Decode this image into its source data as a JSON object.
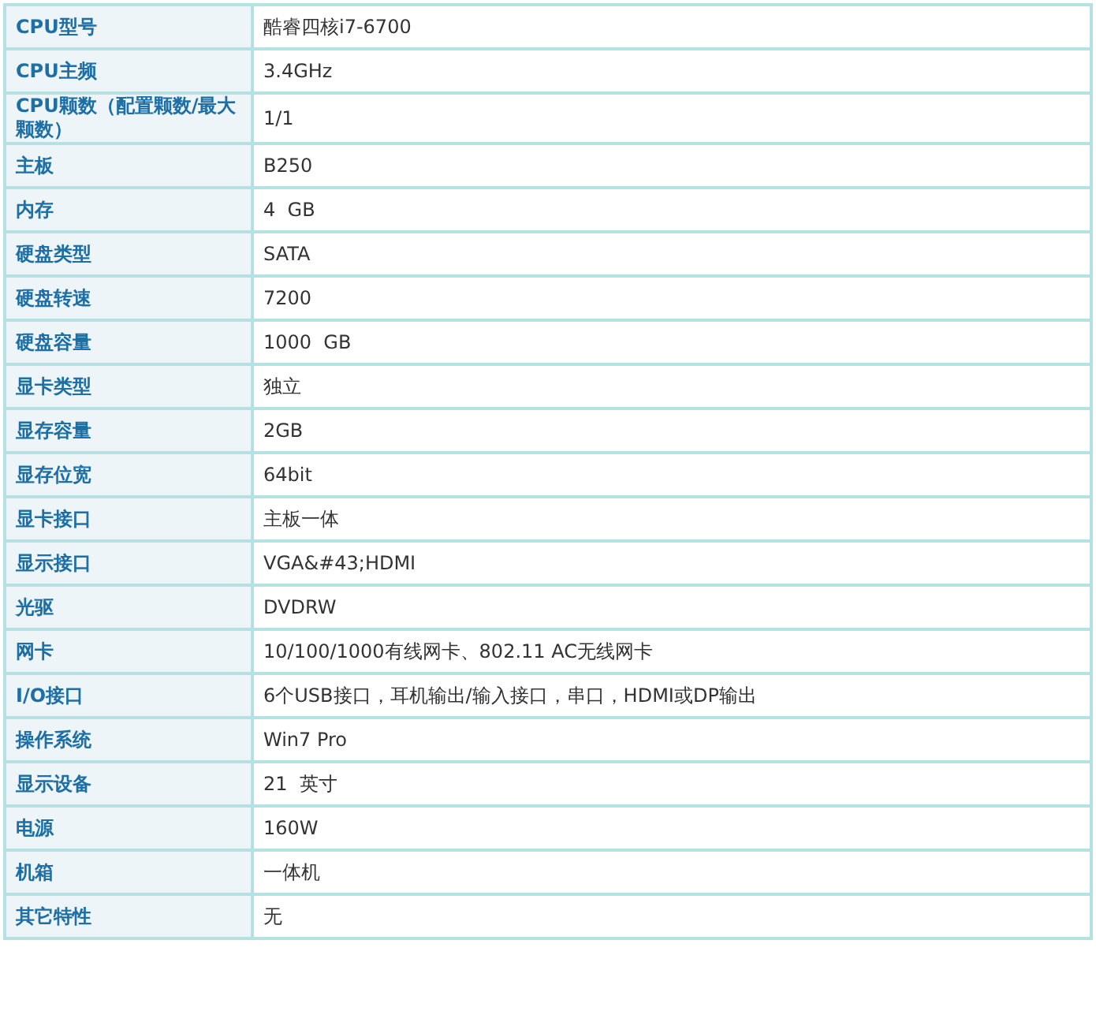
{
  "specs": [
    {
      "label": "CPU型号",
      "value": "酷睿四核i7-6700"
    },
    {
      "label": "CPU主频",
      "value": "3.4GHz"
    },
    {
      "label": "CPU颗数（配置颗数/最大颗数）",
      "value": "1/1"
    },
    {
      "label": "主板",
      "value": "B250"
    },
    {
      "label": "内存",
      "value": "4  GB"
    },
    {
      "label": "硬盘类型",
      "value": "SATA"
    },
    {
      "label": "硬盘转速",
      "value": "7200"
    },
    {
      "label": "硬盘容量",
      "value": "1000  GB"
    },
    {
      "label": "显卡类型",
      "value": "独立"
    },
    {
      "label": "显存容量",
      "value": "2GB"
    },
    {
      "label": "显存位宽",
      "value": "64bit"
    },
    {
      "label": "显卡接口",
      "value": "主板一体"
    },
    {
      "label": "显示接口",
      "value": "VGA&#43;HDMI"
    },
    {
      "label": "光驱",
      "value": "DVDRW"
    },
    {
      "label": "网卡",
      "value": "10/100/1000有线网卡、802.11 AC无线网卡"
    },
    {
      "label": "I/O接口",
      "value": "6个USB接口，耳机输出/输入接口，串口，HDMI或DP输出"
    },
    {
      "label": "操作系统",
      "value": "Win7 Pro"
    },
    {
      "label": "显示设备",
      "value": "21  英寸"
    },
    {
      "label": "电源",
      "value": "160W"
    },
    {
      "label": "机箱",
      "value": "一体机"
    },
    {
      "label": "其它特性",
      "value": "无"
    }
  ]
}
